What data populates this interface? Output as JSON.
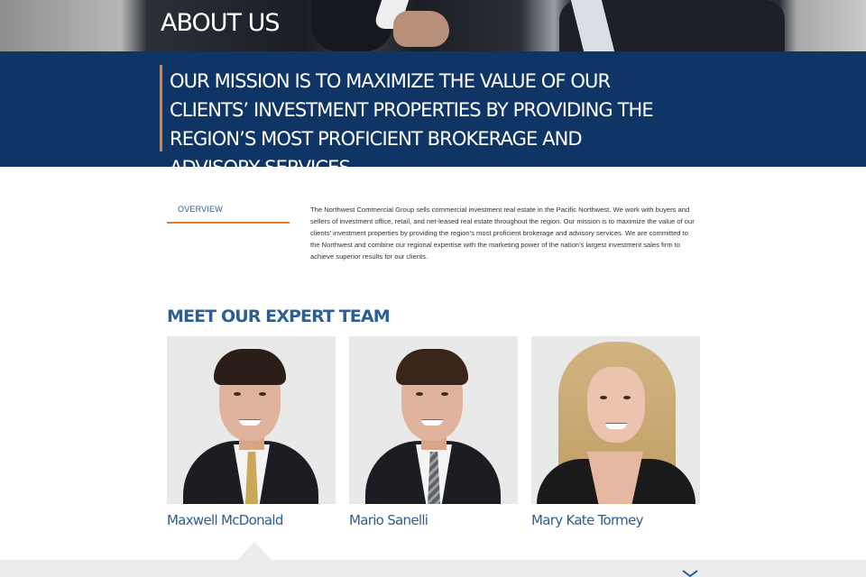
{
  "hero": {
    "title": "ABOUT US"
  },
  "mission": {
    "text": "OUR MISSION IS TO MAXIMIZE THE VALUE OF OUR CLIENTS’ INVESTMENT PROPERTIES BY PROVIDING THE REGION’S MOST PROFICIENT BROKERAGE AND ADVISORY SERVICES.",
    "accent_color": "#e57d2c",
    "background_color": "#0e3566"
  },
  "overview": {
    "tab_label": "OVERVIEW",
    "body": "The Northwest Commercial Group sells commercial investment real estate in the Pacific Northwest. We work with buyers and sellers of investment office, retail, and net-leased real estate throughout the region. Our mission is to maximize the value of our clients’ investment properties by providing the region’s most proficient brokerage and advisory services. We are committed to the Northwest and combine our regional expertise with the marketing power of the nation’s largest investment sales firm to achieve superior results for our clients."
  },
  "team": {
    "heading": "MEET OUR EXPERT TEAM",
    "members": [
      {
        "name": "Maxwell McDonald"
      },
      {
        "name": "Mario Sanelli"
      },
      {
        "name": "Mary Kate Tormey"
      }
    ]
  },
  "colors": {
    "heading_blue": "#2c5f93",
    "accent_orange": "#e57d2c",
    "footer_grey": "#ececec"
  },
  "icons": {
    "bottom": "chevron-down-icon"
  }
}
